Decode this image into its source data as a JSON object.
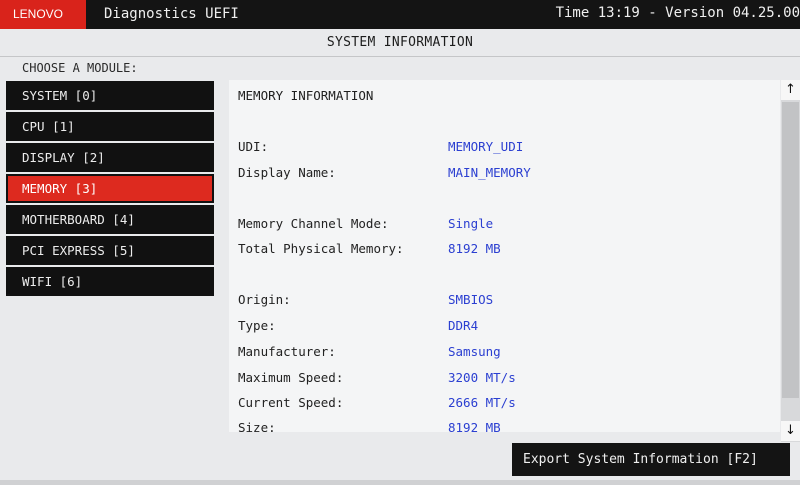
{
  "header": {
    "brand": "LENOVO",
    "app_title": "Diagnostics UEFI",
    "time_version": "Time 13:19 - Version 04.25.00"
  },
  "section_title": "SYSTEM INFORMATION",
  "modules": {
    "prompt": "CHOOSE A MODULE:",
    "items": [
      {
        "label": "SYSTEM [0]",
        "selected": false
      },
      {
        "label": "CPU [1]",
        "selected": false
      },
      {
        "label": "DISPLAY [2]",
        "selected": false
      },
      {
        "label": "MEMORY [3]",
        "selected": true
      },
      {
        "label": "MOTHERBOARD [4]",
        "selected": false
      },
      {
        "label": "PCI EXPRESS [5]",
        "selected": false
      },
      {
        "label": "WIFI [6]",
        "selected": false
      }
    ]
  },
  "panel": {
    "heading": "MEMORY INFORMATION",
    "fields": [
      {
        "label": "UDI:",
        "value": "MEMORY_UDI"
      },
      {
        "label": "Display Name:",
        "value": "MAIN_MEMORY"
      },
      {
        "label": "Memory Channel Mode:",
        "value": "Single"
      },
      {
        "label": "Total Physical Memory:",
        "value": "8192 MB"
      },
      {
        "label": "Origin:",
        "value": "SMBIOS"
      },
      {
        "label": "Type:",
        "value": "DDR4"
      },
      {
        "label": "Manufacturer:",
        "value": "Samsung"
      },
      {
        "label": "Maximum Speed:",
        "value": "3200 MT/s"
      },
      {
        "label": "Current Speed:",
        "value": "2666 MT/s"
      },
      {
        "label": "Size:",
        "value": "8192 MB"
      }
    ]
  },
  "scrollbar": {
    "up_icon": "↑",
    "down_icon": "↓"
  },
  "export_button": "Export System Information [F2]",
  "colors": {
    "accent_red": "#d9231b",
    "value_blue": "#2b3fd1",
    "bar_black": "#141414"
  }
}
